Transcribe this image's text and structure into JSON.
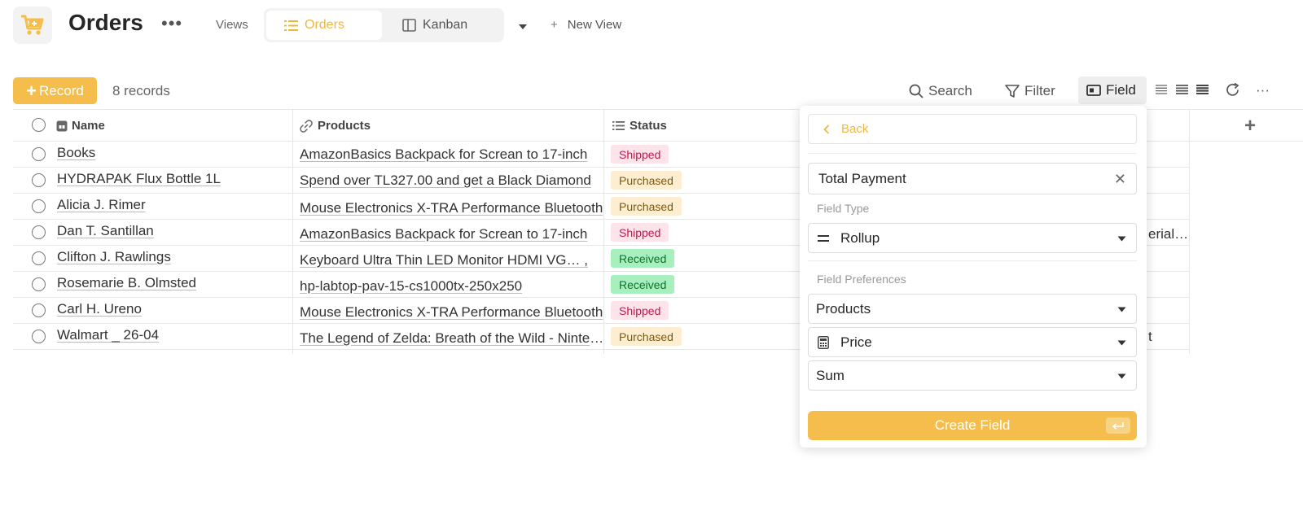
{
  "header": {
    "title": "Orders",
    "more_icon": "ellipsis-icon",
    "views_label": "Views",
    "tabs": [
      {
        "label": "Orders",
        "icon": "list-icon",
        "active": true
      },
      {
        "label": "Kanban",
        "icon": "kanban-icon",
        "active": false
      }
    ],
    "new_view_label": "New View"
  },
  "toolbar": {
    "record_label": "Record",
    "records_count": "8 records",
    "search_label": "Search",
    "filter_label": "Filter",
    "field_label": "Field"
  },
  "table": {
    "columns": [
      {
        "label": "Name",
        "icon": "name-field-icon"
      },
      {
        "label": "Products",
        "icon": "link-icon"
      },
      {
        "label": "Status",
        "icon": "list-icon"
      }
    ],
    "rows": [
      {
        "name": "Books",
        "products": "AmazonBasics Backpack for Screan to 17-inch",
        "status": "Shipped",
        "extra": ""
      },
      {
        "name": "HYDRAPAK Flux Bottle 1L",
        "products": "Spend over TL327.00 and get a Black Diamond",
        "status": "Purchased",
        "extra": ""
      },
      {
        "name": "Alicia J. Rimer",
        "products": "Mouse Electronics X-TRA Performance Bluetooth",
        "status": "Purchased",
        "extra": ""
      },
      {
        "name": "Dan T. Santillan",
        "products": "AmazonBasics Backpack for Screan to 17-inch",
        "status": "Shipped",
        "extra": "erial…"
      },
      {
        "name": "Clifton J. Rawlings",
        "products": "Keyboard Ultra Thin LED Monitor HDMI VG…   ,",
        "status": "Received",
        "extra": ""
      },
      {
        "name": "Rosemarie B. Olmsted",
        "products": "hp-labtop-pav-15-cs1000tx-250x250",
        "status": "Received",
        "extra": ""
      },
      {
        "name": "Carl H. Ureno",
        "products": "Mouse Electronics X-TRA Performance Bluetooth",
        "status": "Shipped",
        "extra": ""
      },
      {
        "name": "Walmart _ 26-04",
        "products": "The Legend of Zelda: Breath of the Wild - Nintendo",
        "status": "Purchased",
        "extra": "t"
      }
    ]
  },
  "panel": {
    "back_label": "Back",
    "field_name": "Total Payment",
    "field_type_label": "Field Type",
    "field_type_value": "Rollup",
    "preferences_label": "Field Preferences",
    "link_field": "Products",
    "target_field": "Price",
    "aggregation": "Sum",
    "create_label": "Create Field"
  },
  "colors": {
    "accent": "#f4bd4c",
    "shipped_bg": "#fde3ea",
    "purchased_bg": "#fdeed2",
    "received_bg": "#a7efbd"
  }
}
